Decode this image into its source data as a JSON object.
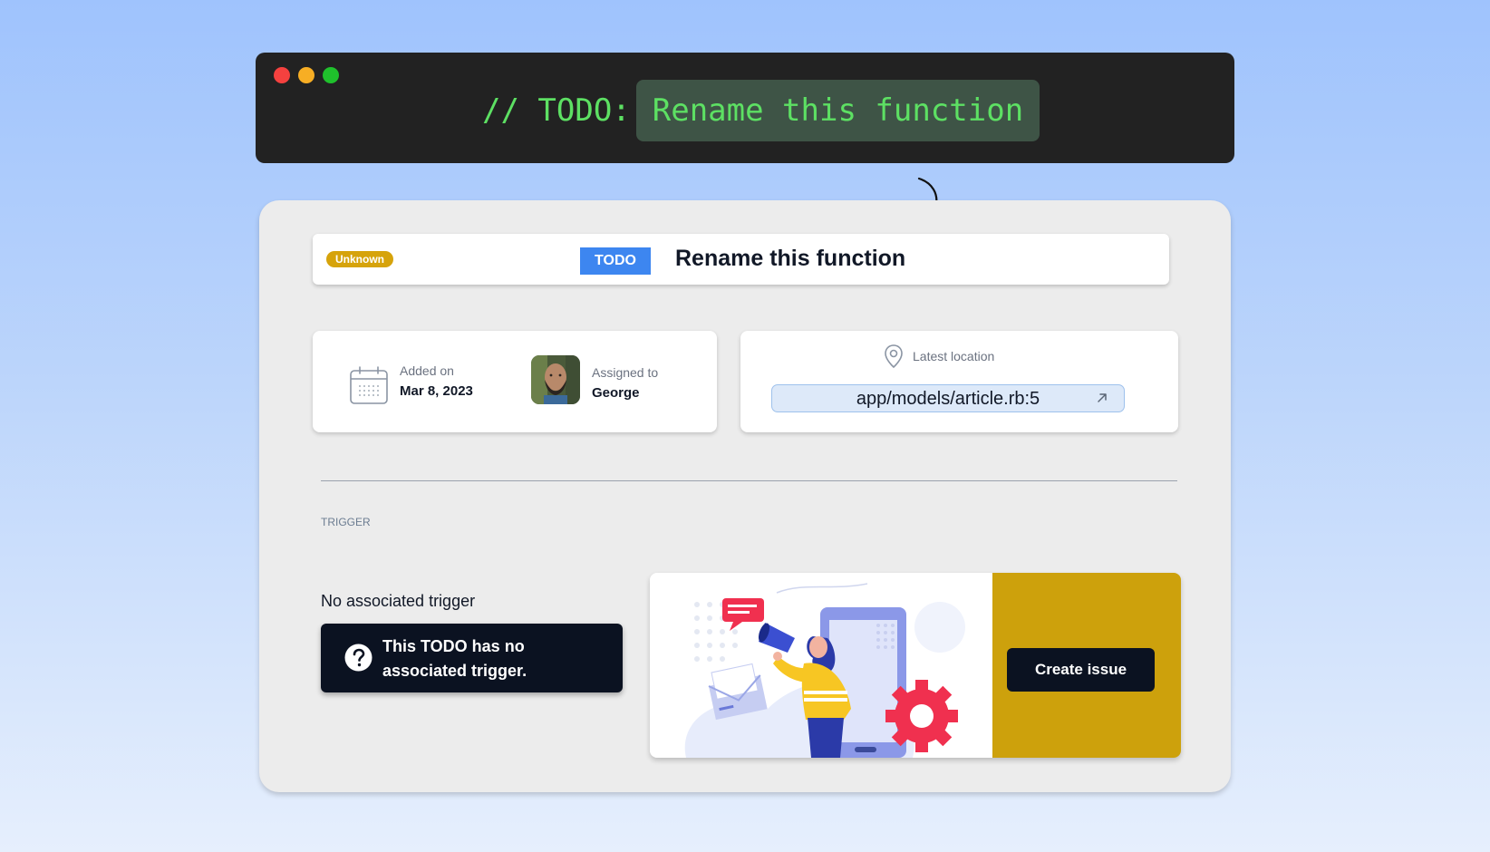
{
  "code_window": {
    "prefix": "// TODO:",
    "highlight": "Rename this function"
  },
  "todo": {
    "status": "Unknown",
    "kind": "TODO",
    "title": "Rename this function",
    "added_label": "Added on",
    "added_date": "Mar 8, 2023",
    "assigned_label": "Assigned to",
    "assignee": "George",
    "location_label": "Latest location",
    "location": "app/models/article.rb:5"
  },
  "trigger": {
    "section_label": "TRIGGER",
    "title": "No associated trigger",
    "message": "This TODO has no associated trigger."
  },
  "promo": {
    "button_label": "Create issue"
  },
  "colors": {
    "status_badge": "#d6a30b",
    "todo_badge": "#3d86f0",
    "promo_accent": "#cda10c",
    "dark": "#0b1221",
    "code_green": "#5de063"
  }
}
